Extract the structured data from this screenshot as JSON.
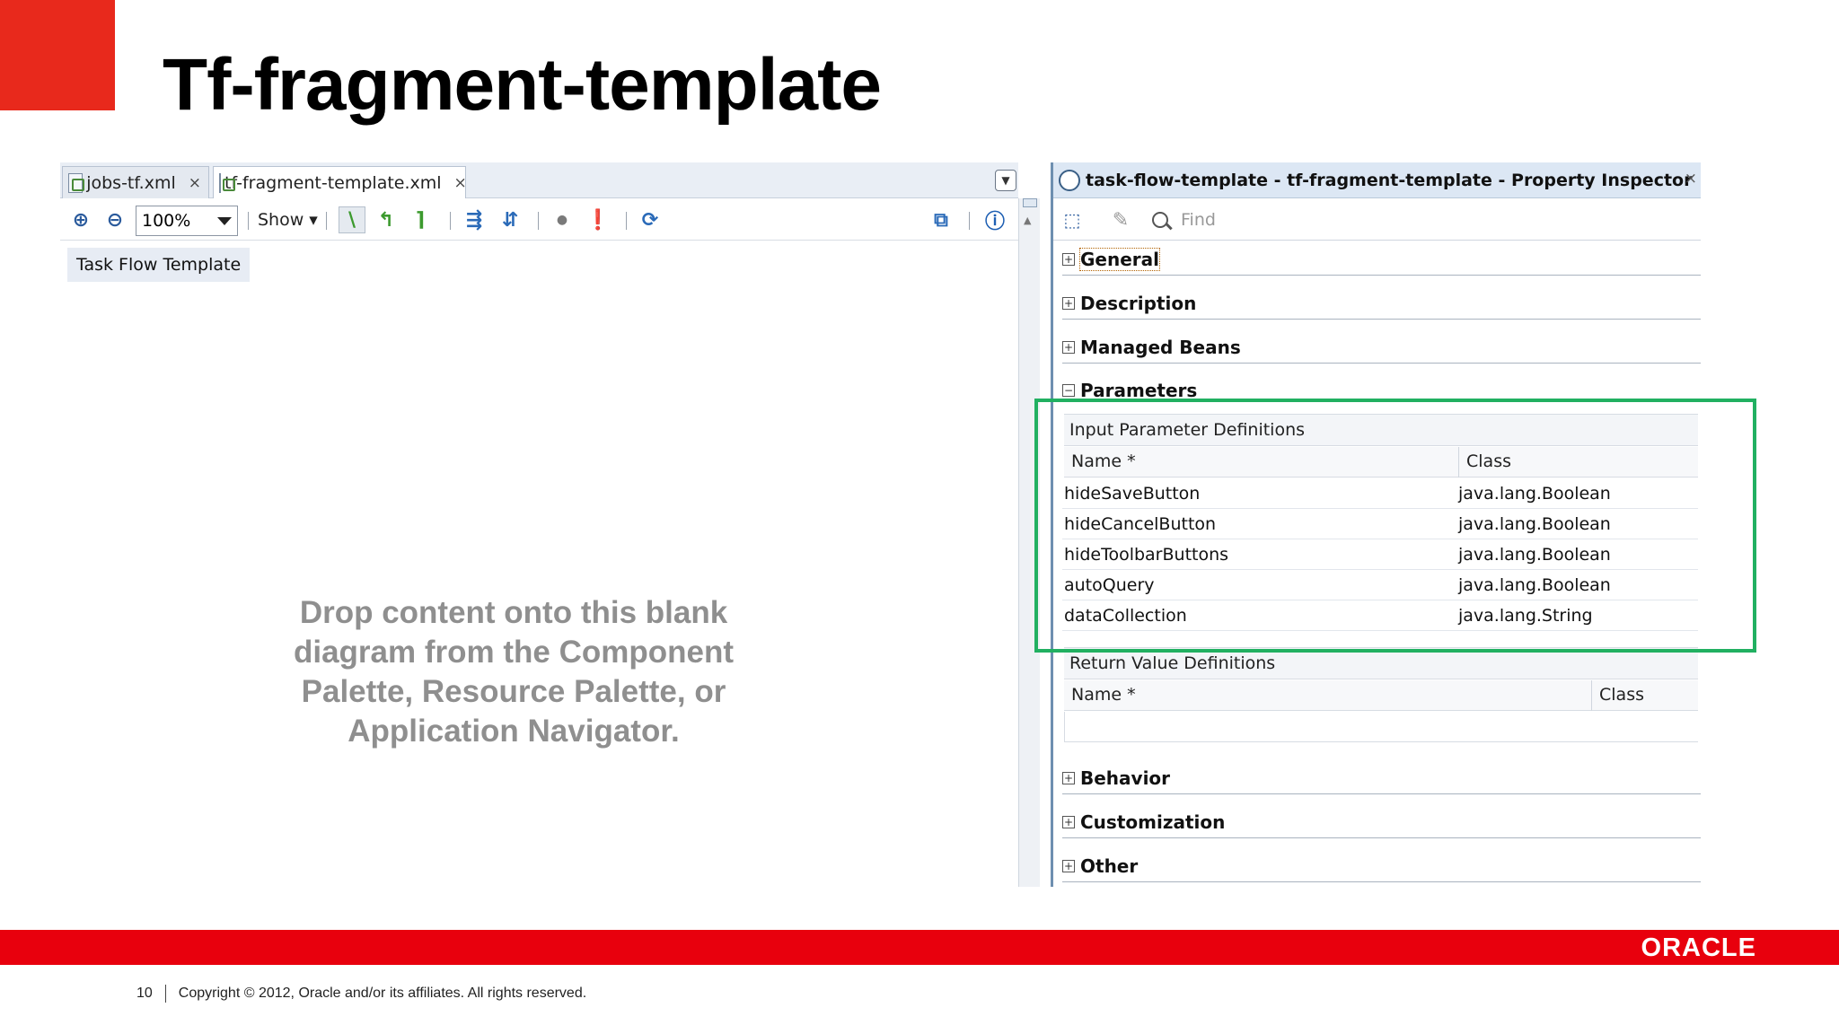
{
  "slide": {
    "title": "Tf-fragment-template",
    "page_number": "10",
    "copyright": "Copyright © 2012, Oracle and/or its affiliates. All rights reserved.",
    "logo_text": "ORACLE",
    "accent_color": "#e8291c",
    "footer_bar_color": "#e8000d"
  },
  "editor": {
    "tabs": [
      {
        "label": "jobs-tf.xml",
        "close": "×"
      },
      {
        "label": "tf-fragment-template.xml",
        "close": "×"
      }
    ],
    "toolbar": {
      "zoom": "100%",
      "show_label": "Show ▾"
    },
    "diagram_label": "Task Flow Template",
    "drop_hint": "Drop content onto this blank diagram from the Component Palette, Resource Palette, or Application Navigator."
  },
  "inspector": {
    "title": "task-flow-template - tf-fragment-template - Property Inspector",
    "close": "×",
    "find_placeholder": "Find",
    "sections": {
      "general": "General",
      "description": "Description",
      "managed_beans": "Managed Beans",
      "parameters": "Parameters",
      "behavior": "Behavior",
      "customization": "Customization",
      "other": "Other"
    },
    "input_params": {
      "header": "Input Parameter Definitions",
      "col_name": "Name *",
      "col_class": "Class",
      "rows": [
        {
          "name": "hideSaveButton",
          "class": "java.lang.Boolean"
        },
        {
          "name": "hideCancelButton",
          "class": "java.lang.Boolean"
        },
        {
          "name": "hideToolbarButtons",
          "class": "java.lang.Boolean"
        },
        {
          "name": "autoQuery",
          "class": "java.lang.Boolean"
        },
        {
          "name": "dataCollection",
          "class": "java.lang.String"
        }
      ]
    },
    "return_values": {
      "header": "Return Value Definitions",
      "col_name": "Name *",
      "col_class": "Class"
    },
    "highlight_color": "#21b061"
  }
}
